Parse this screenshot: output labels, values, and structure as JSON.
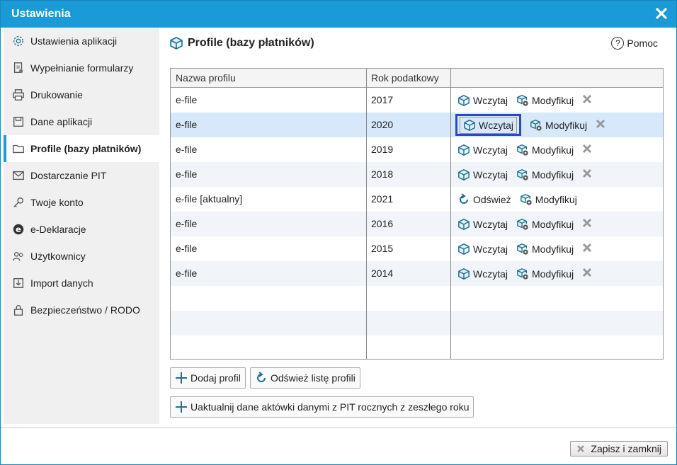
{
  "window": {
    "title": "Ustawienia"
  },
  "sidebar": {
    "items": [
      {
        "label": "Ustawienia aplikacji",
        "icon": "gear-icon"
      },
      {
        "label": "Wypełnianie formularzy",
        "icon": "form-icon"
      },
      {
        "label": "Drukowanie",
        "icon": "printer-icon"
      },
      {
        "label": "Dane aplikacji",
        "icon": "save-icon"
      },
      {
        "label": "Profile (bazy płatników)",
        "icon": "folder-icon",
        "active": true
      },
      {
        "label": "Dostarczanie PIT",
        "icon": "mail-icon"
      },
      {
        "label": "Twoje konto",
        "icon": "key-icon"
      },
      {
        "label": "e-Deklaracje",
        "icon": "e-icon"
      },
      {
        "label": "Użytkownicy",
        "icon": "users-icon"
      },
      {
        "label": "Import danych",
        "icon": "import-icon"
      },
      {
        "label": "Bezpieczeństwo / RODO",
        "icon": "lock-icon"
      }
    ]
  },
  "main": {
    "title": "Profile (bazy płatników)",
    "help_label": "Pomoc",
    "table": {
      "headers": [
        "Nazwa profilu",
        "Rok podatkowy",
        ""
      ],
      "rows": [
        {
          "name": "e-file",
          "year": "2017",
          "load": "Wczytaj",
          "modify": "Modyfikuj"
        },
        {
          "name": "e-file",
          "year": "2020",
          "load": "Wczytaj",
          "modify": "Modyfikuj"
        },
        {
          "name": "e-file",
          "year": "2019",
          "load": "Wczytaj",
          "modify": "Modyfikuj"
        },
        {
          "name": "e-file",
          "year": "2018",
          "load": "Wczytaj",
          "modify": "Modyfikuj"
        },
        {
          "name": "e-file [aktualny]",
          "year": "2021",
          "load": "Odśwież",
          "modify": "Modyfikuj"
        },
        {
          "name": "e-file",
          "year": "2016",
          "load": "Wczytaj",
          "modify": "Modyfikuj"
        },
        {
          "name": "e-file",
          "year": "2015",
          "load": "Wczytaj",
          "modify": "Modyfikuj"
        },
        {
          "name": "e-file",
          "year": "2014",
          "load": "Wczytaj",
          "modify": "Modyfikuj"
        }
      ]
    },
    "buttons": {
      "add_profile": "Dodaj profil",
      "refresh_list": "Odśwież listę profili",
      "update_data": "Uaktualnij dane aktówki danymi z PIT rocznych z zeszłego roku"
    }
  },
  "footer": {
    "save_close": "Zapisz i zamknij"
  },
  "colors": {
    "title_bar": "#1a9ad6",
    "selected_row": "#d6e8fa",
    "focus_border": "#2b4bb8",
    "icon_teal": "#1f6f8b"
  }
}
